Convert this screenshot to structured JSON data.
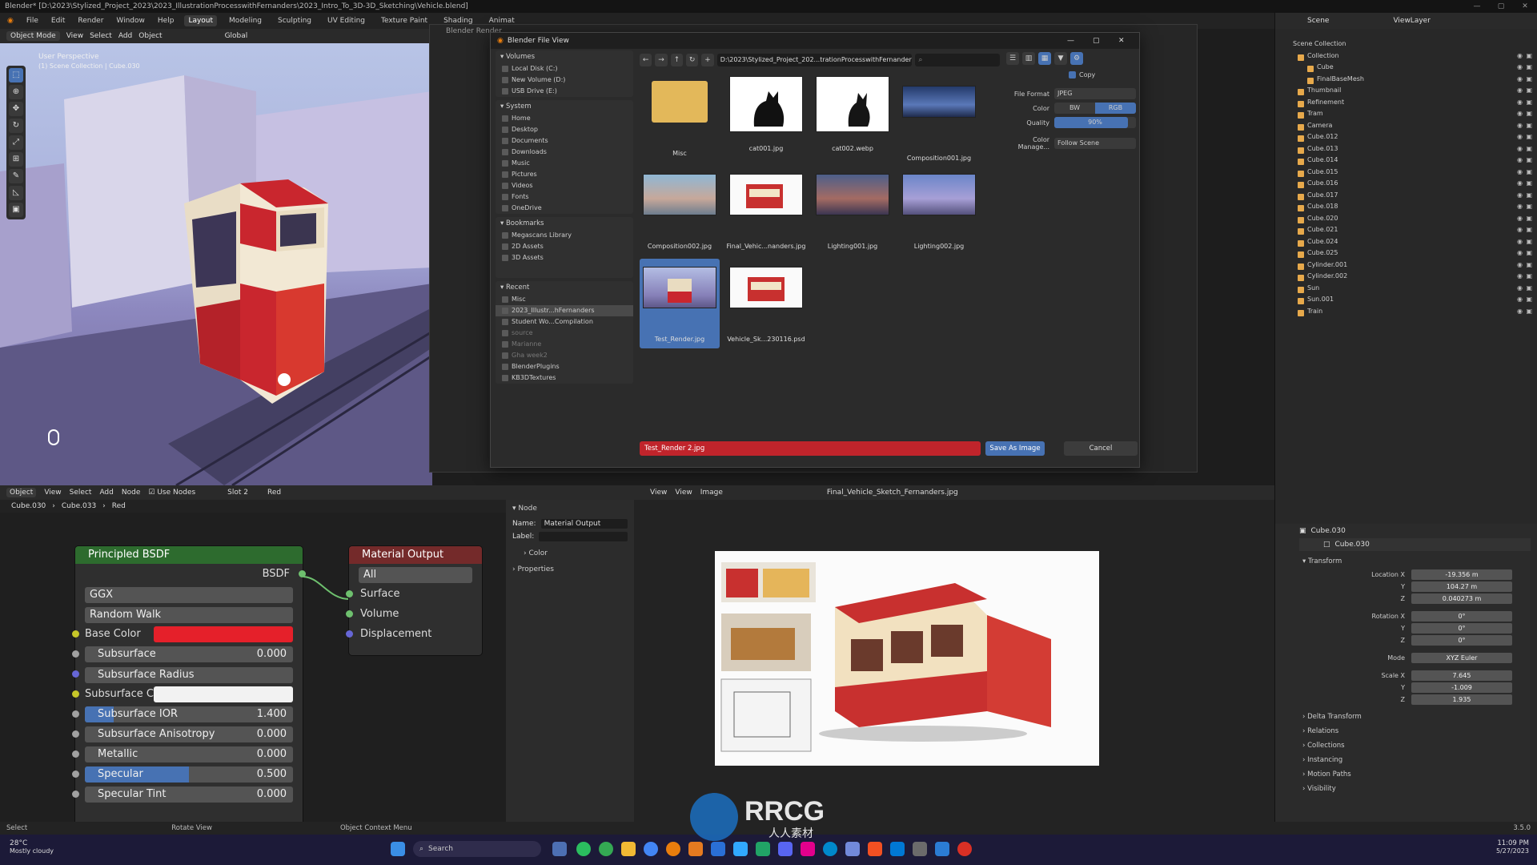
{
  "window": {
    "title": "Blender* [D:\\2023\\Stylized_Project_2023\\2023_IllustrationProcesswithFernanders\\2023_Intro_To_3D-3D_Sketching\\Vehicle.blend]"
  },
  "menu": {
    "items": [
      "File",
      "Edit",
      "Render",
      "Window",
      "Help"
    ],
    "workspaces": [
      "Layout",
      "Modeling",
      "Sculpting",
      "UV Editing",
      "Texture Paint",
      "Shading",
      "Animat"
    ]
  },
  "viewport": {
    "header": [
      "Object Mode",
      "View",
      "Select",
      "Add",
      "Object",
      "Global"
    ],
    "overlay_title": "User Perspective",
    "overlay_sub": "(1) Scene Collection | Cube.030"
  },
  "dialog": {
    "behind_title": "Blender Render",
    "title": "Blender File View",
    "volumes_label": "Volumes",
    "volumes": [
      "Local Disk (C:)",
      "New Volume (D:)",
      "USB Drive (E:)"
    ],
    "system_label": "System",
    "system": [
      "Home",
      "Desktop",
      "Documents",
      "Downloads",
      "Music",
      "Pictures",
      "Videos",
      "Fonts",
      "OneDrive"
    ],
    "bookmarks_label": "Bookmarks",
    "bookmarks": [
      "Megascans Library",
      "2D Assets",
      "3D Assets"
    ],
    "recent_label": "Recent",
    "recent": [
      "Misc",
      "2023_Illustr...hFernanders",
      "Student Wo...Compilation",
      "source",
      "Marianne",
      "Gha week2",
      "BlenderPlugins",
      "KB3DTextures"
    ],
    "path": "D:\\2023\\Stylized_Project_202...trationProcesswithFernanders\\",
    "files": [
      {
        "name": "Misc",
        "kind": "folder"
      },
      {
        "name": "cat001.jpg",
        "kind": "cat"
      },
      {
        "name": "cat002.webp",
        "kind": "cat"
      },
      {
        "name": "Composition001.jpg",
        "kind": "night"
      },
      {
        "name": "Composition002.jpg",
        "kind": "day"
      },
      {
        "name": "Final_Vehic...nanders.jpg",
        "kind": "tram"
      },
      {
        "name": "Lighting001.jpg",
        "kind": "dusk"
      },
      {
        "name": "Lighting002.jpg",
        "kind": "dusk2"
      },
      {
        "name": "Test_Render.jpg",
        "kind": "render",
        "selected": true
      },
      {
        "name": "Vehicle_Sk...230116.psd",
        "kind": "tram"
      }
    ],
    "copy_label": "Copy",
    "file_format_label": "File Format",
    "file_format": "JPEG",
    "color_label": "Color",
    "color_bw": "BW",
    "color_rgb": "RGB",
    "quality_label": "Quality",
    "quality": "90%",
    "quality_fraction": 0.9,
    "color_manage_label": "Color Manage...",
    "color_manage": "Follow Scene",
    "filename": "Test_Render 2.jpg",
    "save_label": "Save As Image",
    "cancel_label": "Cancel"
  },
  "outliner": {
    "scene": "Scene",
    "viewlayer": "ViewLayer",
    "root": "Scene Collection",
    "items": [
      "Collection",
      "Cube",
      "FinalBaseMesh",
      "Thumbnail",
      "Refinement",
      "Tram",
      "Camera",
      "Cube.012",
      "Cube.013",
      "Cube.014",
      "Cube.015",
      "Cube.016",
      "Cube.017",
      "Cube.018",
      "Cube.020",
      "Cube.021",
      "Cube.024",
      "Cube.025",
      "Cylinder.001",
      "Cylinder.002",
      "Sun",
      "Sun.001",
      "Train"
    ]
  },
  "node_editor": {
    "header": [
      "Object",
      "View",
      "Select",
      "Add",
      "Node",
      "Use Nodes",
      "Slot 2",
      "Red"
    ],
    "breadcrumb": [
      "Cube.030",
      "Cube.033",
      "Red"
    ],
    "bsdf": {
      "title": "Principled BSDF",
      "output": "BSDF",
      "dist": "GGX",
      "sss": "Random Walk",
      "rows": [
        {
          "label": "Base Color",
          "type": "color",
          "color": "#e5202a"
        },
        {
          "label": "Subsurface",
          "value": "0.000",
          "fill": 0
        },
        {
          "label": "Subsurface Radius",
          "type": "drop"
        },
        {
          "label": "Subsurface C...",
          "type": "color",
          "color": "#f2f2f2"
        },
        {
          "label": "Subsurface IOR",
          "value": "1.400",
          "fill": 0.14
        },
        {
          "label": "Subsurface Anisotropy",
          "value": "0.000",
          "fill": 0
        },
        {
          "label": "Metallic",
          "value": "0.000",
          "fill": 0
        },
        {
          "label": "Specular",
          "value": "0.500",
          "fill": 0.5
        },
        {
          "label": "Specular Tint",
          "value": "0.000",
          "fill": 0
        }
      ]
    },
    "matout": {
      "title": "Material Output",
      "target": "All",
      "inputs": [
        "Surface",
        "Volume",
        "Displacement"
      ]
    },
    "side": {
      "section": "Node",
      "name_label": "Name:",
      "name": "Material Output",
      "label_label": "Label:",
      "color": "Color",
      "properties": "Properties"
    }
  },
  "image_editor": {
    "header": [
      "View",
      "View",
      "Image"
    ],
    "image_name": "Final_Vehicle_Sketch_Fernanders.jpg"
  },
  "properties": {
    "object": "Cube.030",
    "object2": "Cube.030",
    "transform": "Transform",
    "rows": [
      {
        "label": "Location X",
        "value": "-19.356 m"
      },
      {
        "label": "Y",
        "value": "104.27 m"
      },
      {
        "label": "Z",
        "value": "0.040273 m"
      },
      {
        "label": "Rotation X",
        "value": "0°"
      },
      {
        "label": "Y",
        "value": "0°"
      },
      {
        "label": "Z",
        "value": "0°"
      },
      {
        "label": "Mode",
        "value": "XYZ Euler"
      },
      {
        "label": "Scale X",
        "value": "7.645"
      },
      {
        "label": "Y",
        "value": "-1.009"
      },
      {
        "label": "Z",
        "value": "1.935"
      }
    ],
    "sections": [
      "Delta Transform",
      "Relations",
      "Collections",
      "Instancing",
      "Motion Paths",
      "Visibility"
    ]
  },
  "status": {
    "items": [
      "Select",
      "Rotate View",
      "Object Context Menu"
    ],
    "version": "3.5.0"
  },
  "taskbar": {
    "weather_temp": "28°C",
    "weather_desc": "Mostly cloudy",
    "search": "Search",
    "time": "11:09 PM",
    "date": "5/27/2023"
  },
  "watermark": {
    "text": "RRCG",
    "sub": "人人素材"
  }
}
